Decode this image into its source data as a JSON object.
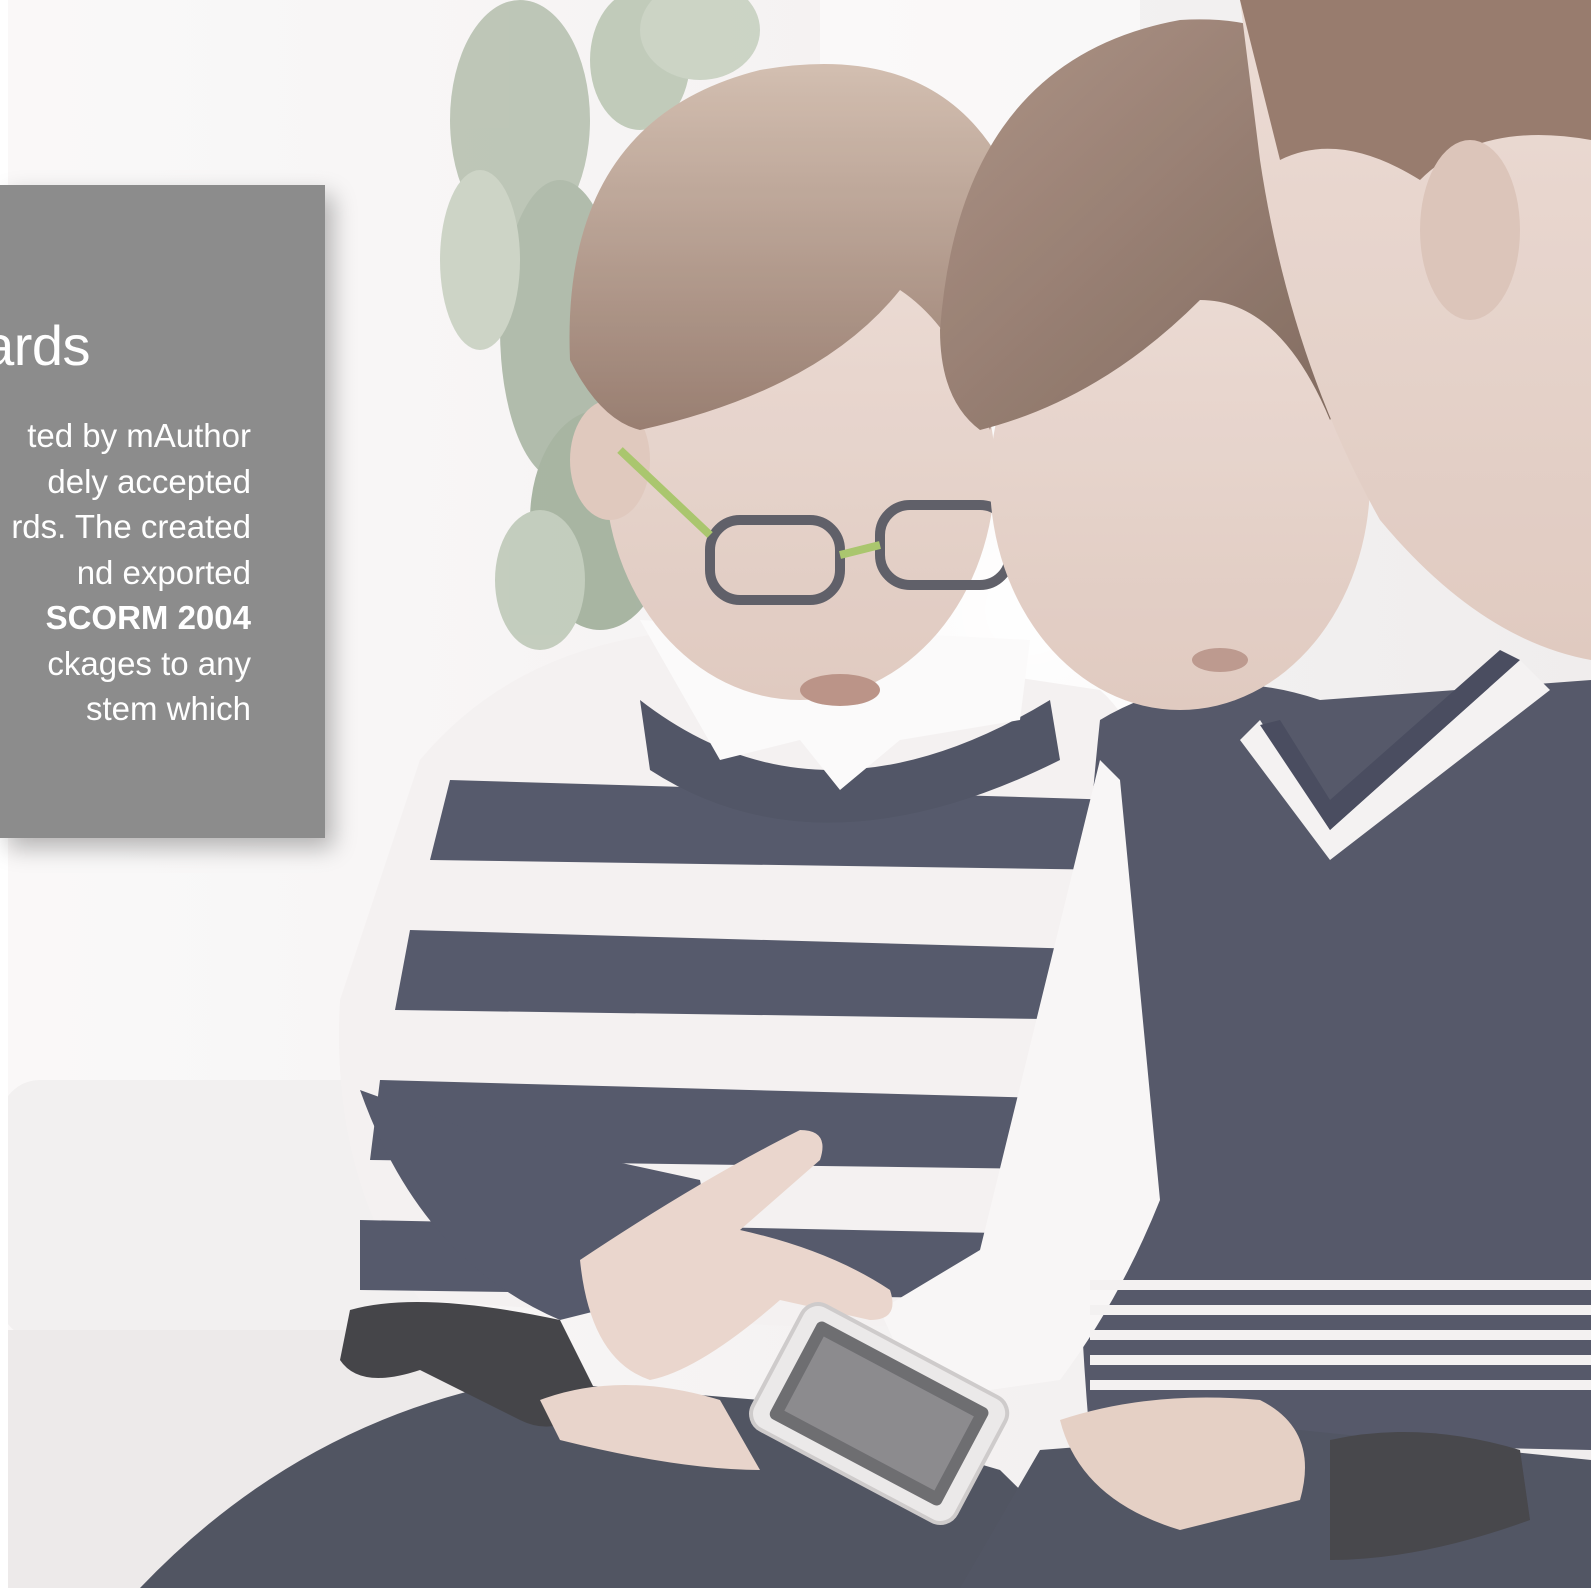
{
  "panel": {
    "title": "ards",
    "lines": [
      {
        "text": "ted by mAuthor",
        "bold": false
      },
      {
        "text": "dely accepted",
        "bold": false
      },
      {
        "text": "rds. The created",
        "bold": false
      },
      {
        "text": "nd exported",
        "bold": false
      },
      {
        "text": "SCORM 2004",
        "bold": true
      },
      {
        "text": "ckages to any",
        "bold": false
      },
      {
        "text": "stem which",
        "bold": false
      }
    ]
  },
  "colors": {
    "panel_bg": "#8c8c8c",
    "panel_text": "#ffffff",
    "photo_tone": "desaturated-warm"
  },
  "image": {
    "subject": "photo-children-tablet"
  }
}
